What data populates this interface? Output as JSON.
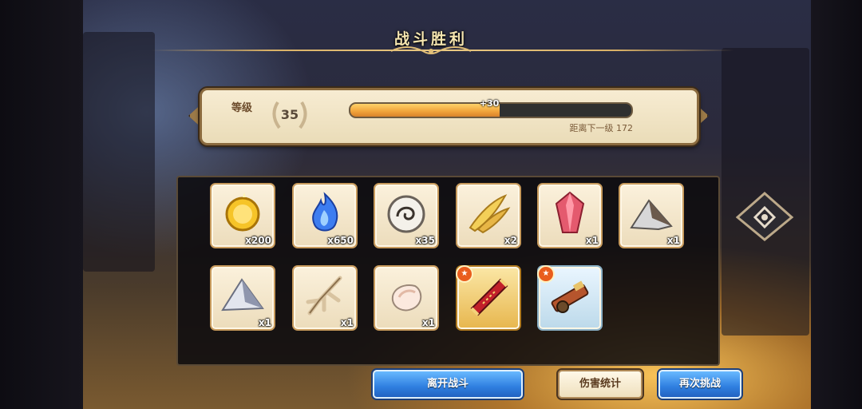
{
  "title": "战斗胜利",
  "level": {
    "label": "等级",
    "value": "35",
    "xp_gain": "+30",
    "progress": 0.53,
    "next_level_text": "距离下一级 172"
  },
  "rewards": [
    {
      "name": "gold-coin",
      "qty": "x200",
      "frame": "normal"
    },
    {
      "name": "blue-flame",
      "qty": "x650",
      "frame": "normal"
    },
    {
      "name": "spirit-orb",
      "qty": "x35",
      "frame": "normal"
    },
    {
      "name": "golden-feathers",
      "qty": "x2",
      "frame": "normal"
    },
    {
      "name": "red-crystal",
      "qty": "x1",
      "frame": "normal"
    },
    {
      "name": "dark-ore",
      "qty": "x1",
      "frame": "normal"
    },
    {
      "name": "silver-ore",
      "qty": "x1",
      "frame": "normal"
    },
    {
      "name": "dry-root",
      "qty": "x1",
      "frame": "normal"
    },
    {
      "name": "white-stone",
      "qty": "x1",
      "frame": "normal"
    },
    {
      "name": "red-scroll",
      "qty": "",
      "frame": "gold"
    },
    {
      "name": "war-cannon",
      "qty": "",
      "frame": "blue"
    }
  ],
  "buttons": {
    "leave": "离开战斗",
    "damage_stats": "伤害统计",
    "retry": "再次挑战"
  },
  "colors": {
    "accent": "#2f7fe0",
    "xp_fill": "#f0a33a",
    "title": "#f6e6b0"
  }
}
